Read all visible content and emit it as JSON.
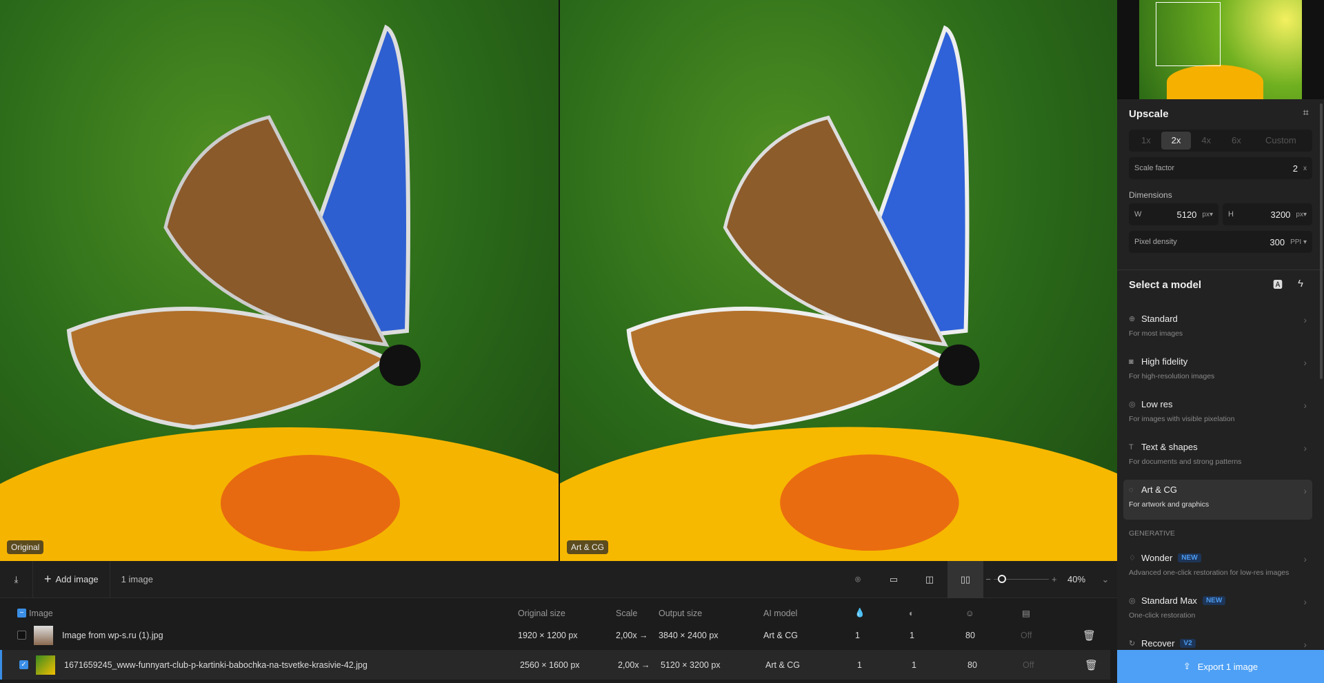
{
  "viewer": {
    "left_label": "Original",
    "right_label": "Art & CG"
  },
  "toolbar": {
    "add_image": "Add image",
    "image_count": "1 image",
    "zoom": "40%",
    "zoom_level_percent": 40
  },
  "table": {
    "headers": {
      "image": "Image",
      "original_size": "Original size",
      "scale": "Scale",
      "output_size": "Output size",
      "ai_model": "AI model"
    },
    "rows": [
      {
        "checked": false,
        "name": "Image from wp-s.ru (1).jpg",
        "original_size": "1920 × 1200 px",
        "scale": "2,00x →",
        "output_size": "3840 × 2400 px",
        "ai_model": "Art & CG",
        "c1": "1",
        "c2": "1",
        "c3": "80",
        "c4": "Off"
      },
      {
        "checked": true,
        "name": "1671659245_www-funnyart-club-p-kartinki-babochka-na-tsvetke-krasivie-42.jpg",
        "original_size": "2560 × 1600 px",
        "scale": "2,00x →",
        "output_size": "5120 × 3200 px",
        "ai_model": "Art & CG",
        "c1": "1",
        "c2": "1",
        "c3": "80",
        "c4": "Off"
      }
    ]
  },
  "panel": {
    "upscale_title": "Upscale",
    "scales": [
      "1x",
      "2x",
      "4x",
      "6x",
      "Custom"
    ],
    "scale_factor_label": "Scale factor",
    "scale_factor": "2",
    "scale_factor_unit": "x",
    "dimensions_label": "Dimensions",
    "w_label": "W",
    "w": "5120",
    "w_unit": "px▾",
    "h_label": "H",
    "h": "3200",
    "h_unit": "px▾",
    "density_label": "Pixel density",
    "density": "300",
    "density_unit": "PPI ▾",
    "model_title": "Select a model",
    "models": [
      {
        "name": "Standard",
        "desc": "For most images",
        "icon": "globe-icon",
        "glyph": "⊕"
      },
      {
        "name": "High fidelity",
        "desc": "For high-resolution images",
        "icon": "camera-icon",
        "glyph": "◙"
      },
      {
        "name": "Low res",
        "desc": "For images with visible pixelation",
        "icon": "grid-circle-icon",
        "glyph": "◎"
      },
      {
        "name": "Text & shapes",
        "desc": "For documents and strong patterns",
        "icon": "text-icon",
        "glyph": "T"
      },
      {
        "name": "Art & CG",
        "desc": "For artwork and graphics",
        "icon": "palette-icon",
        "glyph": "◌"
      }
    ],
    "generative_label": "GENERATIVE",
    "gen_models": [
      {
        "name": "Wonder",
        "badge": "NEW",
        "desc": "Advanced one-click restoration for low-res images",
        "icon": "gem-icon",
        "glyph": "♢"
      },
      {
        "name": "Standard Max",
        "badge": "NEW",
        "desc": "One-click restoration",
        "icon": "target-icon",
        "glyph": "◎"
      },
      {
        "name": "Recover",
        "badge": "V2",
        "desc": "",
        "icon": "refresh-icon",
        "glyph": "↻"
      }
    ],
    "export": "Export 1 image"
  },
  "colors": {
    "accent": "#4da0f5",
    "badge": "#4d9bf0"
  }
}
